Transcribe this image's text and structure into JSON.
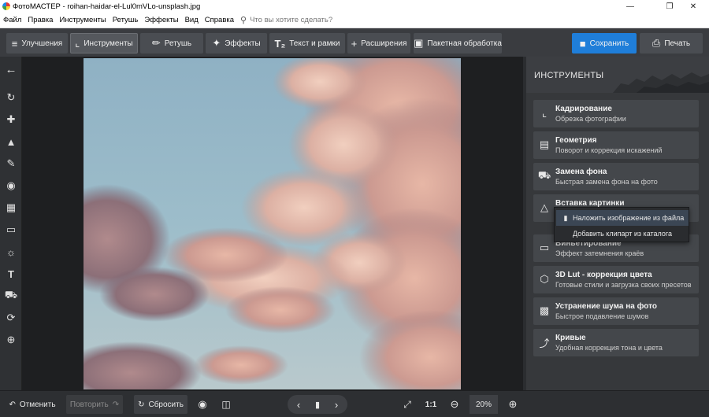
{
  "window": {
    "title": "ФотоМАСТЕР - roihan-haidar-el-Lul0mVLo-unsplash.jpg",
    "minimize": "—",
    "maximize": "❐",
    "close": "✕"
  },
  "menu": {
    "items": [
      "Файл",
      "Правка",
      "Инструменты",
      "Ретушь",
      "Эффекты",
      "Вид",
      "Справка"
    ],
    "search_placeholder": "Что вы хотите сделать?"
  },
  "toolbar": {
    "tabs": [
      {
        "label": "Улучшения",
        "icon": "sliders-icon"
      },
      {
        "label": "Инструменты",
        "icon": "crop-icon"
      },
      {
        "label": "Ретушь",
        "icon": "brush-icon"
      },
      {
        "label": "Эффекты",
        "icon": "magic-wand-icon"
      },
      {
        "label": "Текст и рамки",
        "icon": "text-icon"
      },
      {
        "label": "Расширения",
        "icon": "plus-icon"
      }
    ],
    "active_tab": "Инструменты",
    "batch_label": "Пакетная обработка",
    "save_label": "Сохранить",
    "print_label": "Печать",
    "accent": "#1f7ed9"
  },
  "left_rail": {
    "icons": [
      "back-arrow-icon",
      "rotate-icon",
      "bandage-icon",
      "stamp-icon",
      "brush-icon",
      "radial-icon",
      "gradient-icon",
      "vignette-icon",
      "sun-icon",
      "text-icon",
      "fill-bucket-icon",
      "lasso-icon",
      "target-icon"
    ]
  },
  "right_panel": {
    "title": "ИНСТРУМЕНТЫ",
    "tools": [
      {
        "title": "Кадрирование",
        "subtitle": "Обрезка фотографии",
        "icon": "crop-icon"
      },
      {
        "title": "Геометрия",
        "subtitle": "Поворот и коррекция искажений",
        "icon": "geometry-icon"
      },
      {
        "title": "Замена фона",
        "subtitle": "Быстрая замена фона на фото",
        "icon": "bucket-icon"
      },
      {
        "title": "Вставка картинки",
        "subtitle": "",
        "icon": "image-insert-icon"
      },
      {
        "title": "Виньетирование",
        "subtitle": "Эффект затемнения краёв",
        "icon": "vignette-icon"
      },
      {
        "title": "3D Lut - коррекция цвета",
        "subtitle": "Готовые стили и загрузка своих пресетов",
        "icon": "cube-icon"
      },
      {
        "title": "Устранение шума на фото",
        "subtitle": "Быстрое подавление шумов",
        "icon": "noise-icon"
      },
      {
        "title": "Кривые",
        "subtitle": "Удобная коррекция тона и цвета",
        "icon": "curves-icon"
      }
    ],
    "dropdown": [
      {
        "label": "Наложить изображение из файла",
        "icon": "folder-icon",
        "selected": true
      },
      {
        "label": "Добавить клипарт из каталога",
        "icon": "",
        "selected": false
      }
    ]
  },
  "bottom": {
    "undo_label": "Отменить",
    "redo_label": "Повторить",
    "reset_label": "Сбросить",
    "ratio_label": "1:1",
    "zoom_value": "20%"
  }
}
